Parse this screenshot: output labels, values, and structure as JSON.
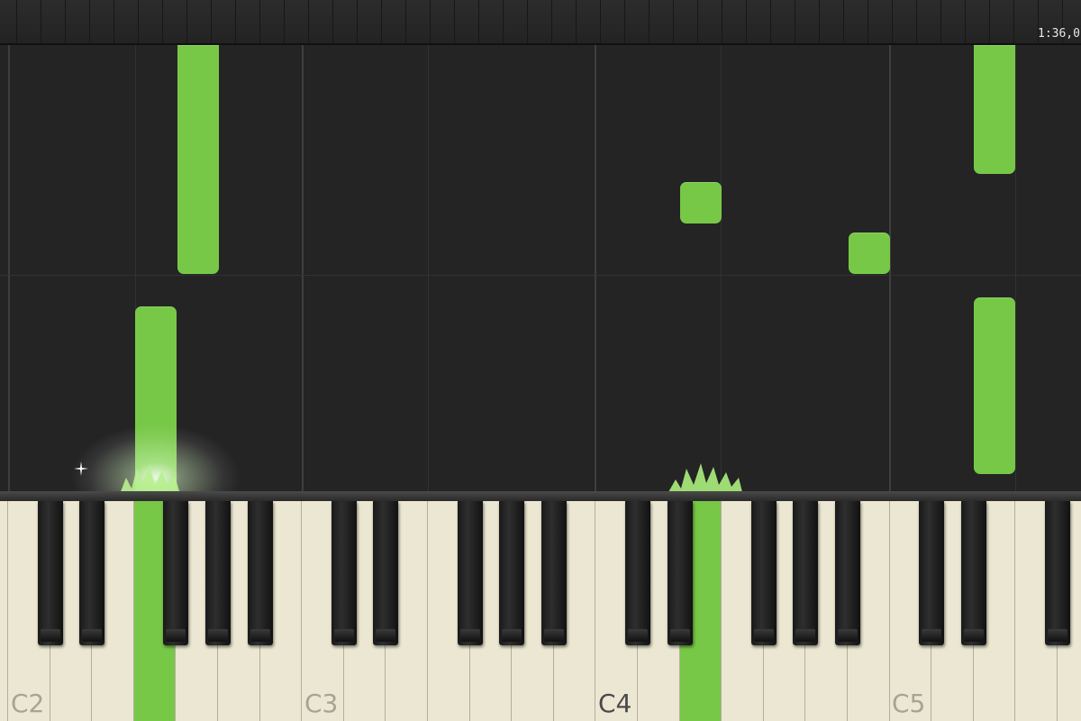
{
  "timer": {
    "elapsed": "1:36,0"
  },
  "colors": {
    "note": "#78c848",
    "background": "#242424",
    "white_key": "#ece7d2",
    "black_key": "#1a1a1a",
    "hit_line": "#b02020"
  },
  "keyboard": {
    "octave_labels": [
      {
        "text": "C2",
        "style": "light"
      },
      {
        "text": "C3",
        "style": "light"
      },
      {
        "text": "C4",
        "style": "dark"
      },
      {
        "text": "C5",
        "style": "light"
      }
    ],
    "active_keys": [
      "C#2-area-white",
      "C4-area-black"
    ]
  },
  "falling_notes_count": 7
}
